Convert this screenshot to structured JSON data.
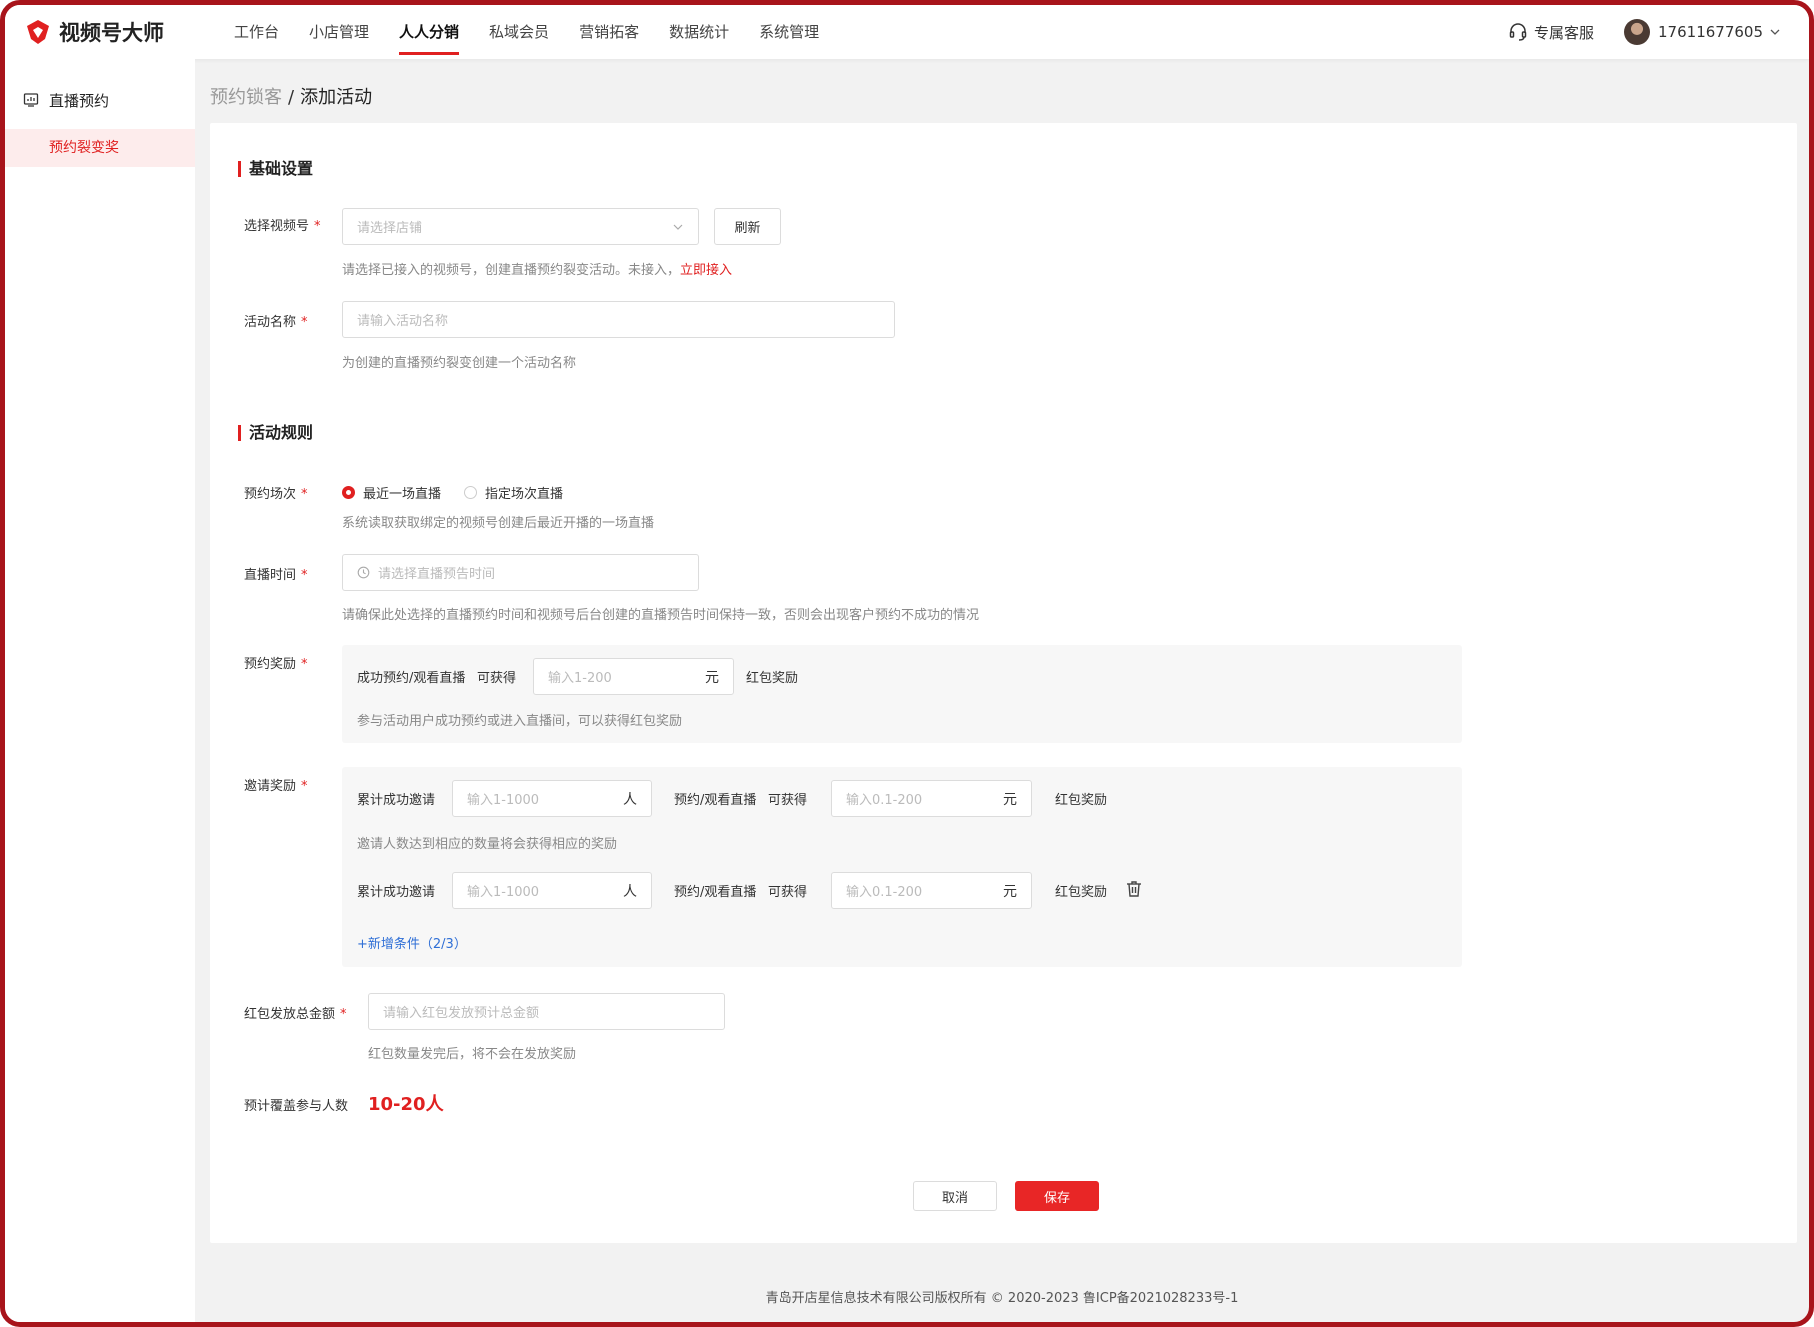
{
  "app": {
    "name": "视频号大师"
  },
  "nav": {
    "items": [
      {
        "label": "工作台"
      },
      {
        "label": "小店管理"
      },
      {
        "label": "人人分销"
      },
      {
        "label": "私域会员"
      },
      {
        "label": "营销拓客"
      },
      {
        "label": "数据统计"
      },
      {
        "label": "系统管理"
      }
    ],
    "active_index": 2
  },
  "header": {
    "support_label": "专属客服",
    "user_phone": "17611677605"
  },
  "sidebar": {
    "group_label": "直播预约",
    "active_item": "预约裂变奖"
  },
  "breadcrumb": {
    "parent": "预约锁客",
    "separator": "/",
    "current": "添加活动"
  },
  "basic": {
    "title": "基础设置",
    "channel": {
      "label": "选择视频号",
      "placeholder": "请选择店铺",
      "refresh_label": "刷新",
      "hint": "请选择已接入的视频号，创建直播预约裂变活动。未接入，",
      "hint_link": "立即接入"
    },
    "name": {
      "label": "活动名称",
      "placeholder": "请输入活动名称",
      "hint": "为创建的直播预约裂变创建一个活动名称"
    }
  },
  "rules": {
    "title": "活动规则",
    "session": {
      "label": "预约场次",
      "options": [
        "最近一场直播",
        "指定场次直播"
      ],
      "selected_index": 0,
      "hint": "系统读取获取绑定的视频号创建后最近开播的一场直播"
    },
    "time": {
      "label": "直播时间",
      "placeholder": "请选择直播预告时间",
      "hint": "请确保此处选择的直播预约时间和视频号后台创建的直播预告时间保持一致，否则会出现客户预约不成功的情况"
    },
    "reserve_reward": {
      "label": "预约奖励",
      "prefix": "成功预约/观看直播",
      "can_get": "可获得",
      "placeholder": "输入1-200",
      "unit": "元",
      "reward": "红包奖励",
      "hint": "参与活动用户成功预约或进入直播间，可以获得红包奖励"
    },
    "invite_reward": {
      "label": "邀请奖励",
      "rows": [
        {
          "prefix": "累计成功邀请",
          "count_placeholder": "输入1-1000",
          "count_unit": "人",
          "mid": "预约/观看直播",
          "can_get": "可获得",
          "amount_placeholder": "输入0.1-200",
          "amount_unit": "元",
          "reward": "红包奖励"
        },
        {
          "prefix": "累计成功邀请",
          "count_placeholder": "输入1-1000",
          "count_unit": "人",
          "mid": "预约/观看直播",
          "can_get": "可获得",
          "amount_placeholder": "输入0.1-200",
          "amount_unit": "元",
          "reward": "红包奖励"
        }
      ],
      "hint": "邀请人数达到相应的数量将会获得相应的奖励",
      "add_label": "+新增条件（2/3）"
    },
    "total": {
      "label": "红包发放总金额",
      "placeholder": "请输入红包发放预计总金额",
      "hint": "红包数量发完后，将不会在发放奖励"
    },
    "estimate": {
      "label": "预计覆盖参与人数",
      "value": "10-20人"
    }
  },
  "actions": {
    "cancel": "取消",
    "save": "保存"
  },
  "footer": {
    "text": "青岛开店星信息技术有限公司版权所有 © 2020-2023 鲁ICP备2021028233号-1"
  },
  "colors": {
    "accent": "#e02020",
    "link": "#2f6fd6",
    "frame": "#a8141b"
  }
}
